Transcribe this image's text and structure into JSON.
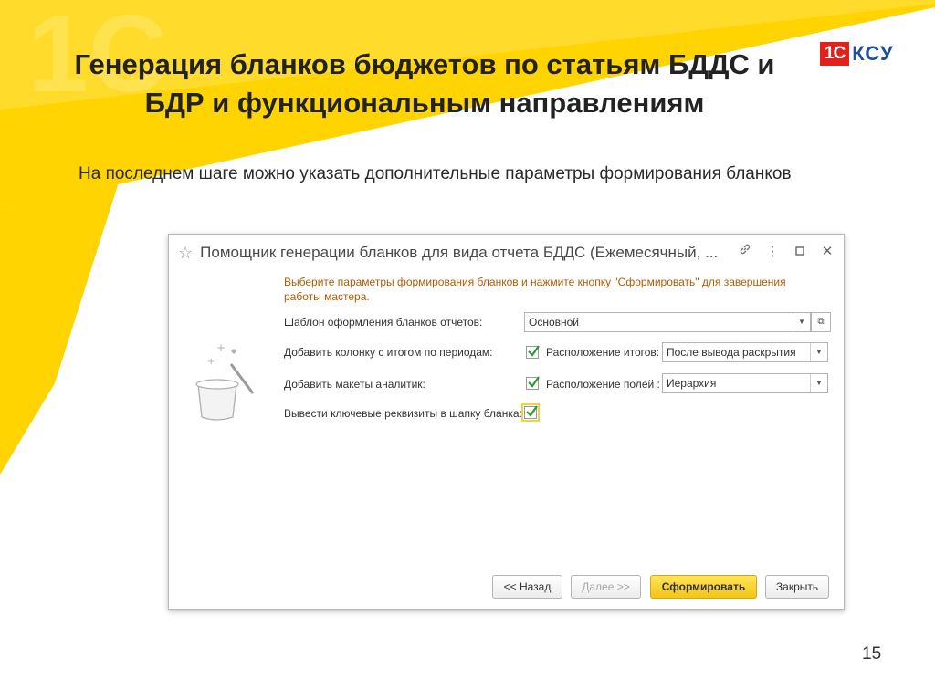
{
  "slide": {
    "title_line1": "Генерация бланков бюджетов по статьям БДДС и",
    "title_line2": "БДР и функциональным направлениям",
    "logo_mark": "1С",
    "logo_text": "КСУ",
    "subtitle": "На последнем шаге можно указать дополнительные параметры формирования бланков",
    "page_number": "15",
    "colors": {
      "accent_yellow": "#ffd400",
      "logo_red": "#e2211c",
      "logo_blue": "#1e4e9c"
    }
  },
  "window": {
    "title": "Помощник генерации бланков для вида отчета БДДС (Ежемесячный, ...",
    "controls": [
      "link-icon",
      "more-icon",
      "maximize-icon",
      "close-icon"
    ],
    "hint": "Выберите параметры формирования бланков и нажмите кнопку \"Сформировать\" для завершения работы мастера.",
    "fields": {
      "template_label": "Шаблон оформления бланков отчетов:",
      "template_value": "Основной",
      "totals_label": "Добавить колонку с итогом по периодам:",
      "totals_checked": true,
      "totals_position_label": "Расположение итогов:",
      "totals_position_value": "После вывода раскрытия",
      "analytics_label": "Добавить макеты аналитик:",
      "analytics_checked": true,
      "fields_position_label": "Расположение полей :",
      "fields_position_value": "Иерархия",
      "key_props_label": "Вывести ключевые реквизиты в шапку бланка:",
      "key_props_checked": true
    },
    "buttons": {
      "back": "<< Назад",
      "next": "Далее >>",
      "generate": "Сформировать",
      "close": "Закрыть"
    },
    "illustration": "magic-hat-icon"
  }
}
